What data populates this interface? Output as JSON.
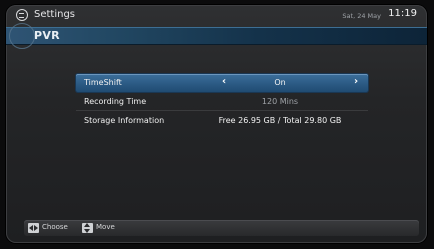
{
  "header": {
    "app_title": "Settings",
    "date": "Sat, 24 May",
    "time": "11:19"
  },
  "section": {
    "title": "PVR"
  },
  "menu": {
    "items": [
      {
        "label": "TimeShift",
        "value": "On",
        "selected": true,
        "has_arrows": true
      },
      {
        "label": "Recording Time",
        "value": "120 Mins",
        "selected": false,
        "has_arrows": false
      },
      {
        "label": "Storage Information",
        "value": "Free 26.95 GB / Total 29.80 GB",
        "selected": false,
        "has_arrows": false
      }
    ],
    "arrow_left": "‹",
    "arrow_right": "›"
  },
  "footer": {
    "choose_label": "Choose",
    "move_label": "Move",
    "choose_icon": "left-right-key-icon",
    "move_icon": "up-down-key-icon"
  },
  "colors": {
    "selection": "#2b5a84",
    "section_bar": "#224863",
    "background": "#242527"
  }
}
